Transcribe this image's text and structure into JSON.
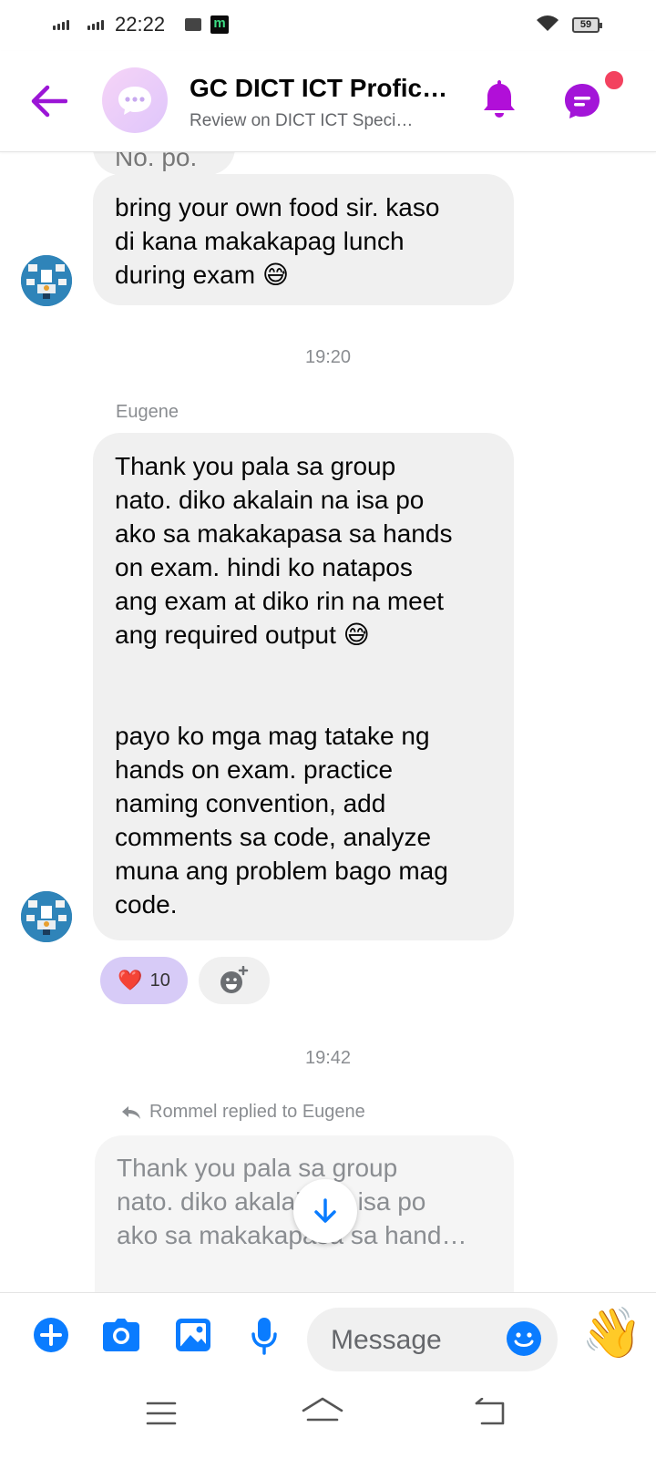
{
  "status_bar": {
    "time": "22:22",
    "battery": "59"
  },
  "header": {
    "title": "GC DICT ICT Profic…",
    "subtitle": "Review on DICT ICT Speci…"
  },
  "messages": {
    "partial_top": "No. po.",
    "msg1": [
      "bring your own food sir. kaso",
      "di kana makakapag lunch",
      "during exam 😅"
    ],
    "time1": "19:20",
    "sender2": "Eugene",
    "msg2": [
      "Thank you pala sa group",
      "nato. diko akalain na isa po",
      "ako sa makakapasa sa hands",
      "on exam. hindi ko natapos",
      "ang exam at diko rin na meet",
      "ang required output 😅",
      "",
      "",
      "payo ko mga mag tatake ng",
      "hands on exam. practice",
      "naming convention, add",
      "comments sa code, analyze",
      "muna ang problem bago mag",
      "code."
    ],
    "reaction_emoji": "❤️",
    "reaction_count": "10",
    "time2": "19:42",
    "reply_meta": "Rommel replied to Eugene",
    "reply_quote": [
      "Thank you pala sa group",
      "nato. diko akalain na isa po",
      "ako sa makakapasa sa hand…"
    ]
  },
  "composer": {
    "placeholder": "Message",
    "wave": "👋"
  },
  "colors": {
    "accent": "#9b15d6",
    "messenger_blue": "#0a7cff",
    "notify": "#f3425f",
    "bubble": "#f0f0f0"
  }
}
